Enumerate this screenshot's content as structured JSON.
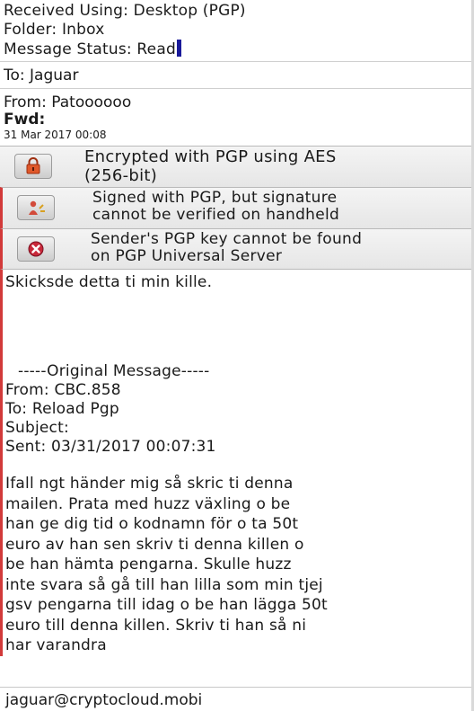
{
  "header": {
    "received_using": "Received Using: Desktop (PGP)",
    "folder": "Folder: Inbox",
    "message_status": "Message Status: Read",
    "to": "To: Jaguar"
  },
  "message": {
    "from": "From: Patoooooo",
    "subject": "Fwd:",
    "date": "31 Mar 2017 00:08"
  },
  "security": [
    {
      "icon": "lock-icon",
      "text_line1": "Encrypted with PGP using AES",
      "text_line2": "(256-bit)"
    },
    {
      "icon": "signature-person-icon",
      "text_line1": "Signed with PGP, but signature",
      "text_line2": "cannot be verified on handheld"
    },
    {
      "icon": "error-x-icon",
      "text_line1": "Sender's PGP key cannot be found",
      "text_line2": "on PGP Universal Server"
    }
  ],
  "body": {
    "greeting": "Skicksde  detta ti min kille.",
    "original_header": "-----Original Message-----",
    "orig_from": "From: CBC.858",
    "orig_to": "To: Reload Pgp",
    "orig_subject": "Subject:",
    "orig_sent": "Sent: 03/31/2017 00:07:31",
    "paragraph": "Ifall ngt händer mig så skric ti denna\nmailen.  Prata med huzz växling o be\nhan ge dig tid o kodnamn för o ta 50t\neuro av han sen skriv ti denna killen o\nbe han hämta pengarna. Skulle huzz\ninte svara så gå till han lilla som min tjej\ngsv pengarna till idag o be han lägga 50t\neuro till denna killen.  Skriv ti han så ni\nhar varandra"
  },
  "footer": {
    "email": "jaguar@cryptocloud.mobi"
  },
  "colors": {
    "alert_red": "#d23a3a",
    "lock_orange": "#e0582a",
    "cursor_blue": "#1a1a9a"
  }
}
